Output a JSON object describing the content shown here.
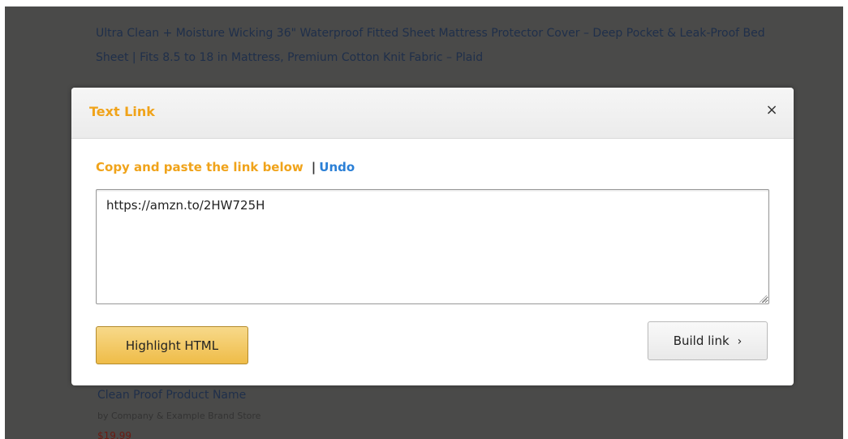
{
  "background": {
    "product_title": "Ultra Clean + Moisture Wicking 36\" Waterproof Fitted Sheet Mattress Protector Cover – Deep Pocket & Leak-Proof Bed Sheet | Fits 8.5 to 18 in Mattress, Premium Cotton Knit Fabric – Plaid",
    "bottom_title": "Clean Proof Product Name",
    "bottom_subtitle": "by Company & Example Brand Store",
    "bottom_price": "$19.99"
  },
  "modal": {
    "title": "Text Link",
    "close_symbol": "×",
    "instruction": "Copy and paste the link below",
    "separator": "|",
    "undo_label": "Undo",
    "link_value": "https://amzn.to/2HW725H",
    "highlight_button_label": "Highlight HTML",
    "build_button_label": "Build link",
    "build_chevron": "›"
  },
  "colors": {
    "accent_orange": "#f0a31a",
    "link_blue": "#2a7fd6",
    "button_yellow": "#efbc48",
    "backdrop": "#4a4a49"
  },
  "icons": {
    "close": "close-icon",
    "build_chevron": "chevron-right-icon",
    "resize": "resize-grip-icon"
  }
}
